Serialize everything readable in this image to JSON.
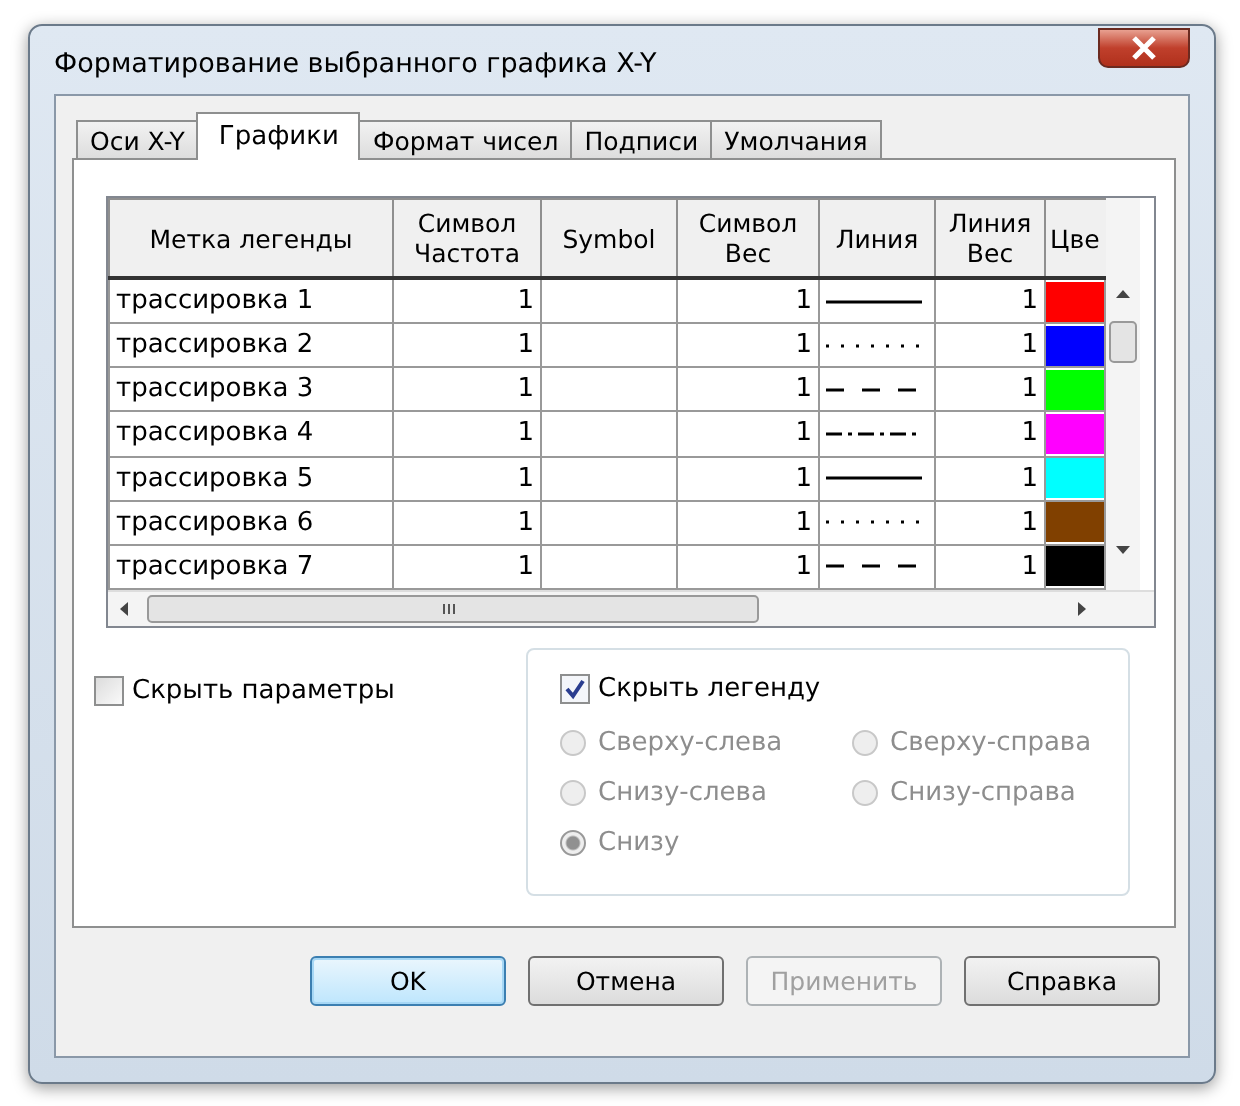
{
  "window": {
    "title": "Форматирование выбранного графика X-Y"
  },
  "tabs": [
    {
      "label": "Оси X-Y",
      "selected": false
    },
    {
      "label": "Графики",
      "selected": true
    },
    {
      "label": "Формат чисел",
      "selected": false
    },
    {
      "label": "Подписи",
      "selected": false
    },
    {
      "label": "Умолчания",
      "selected": false
    }
  ],
  "table": {
    "columns": [
      "Метка легенды",
      "Символ Частота",
      "Symbol",
      "Символ Вес",
      "Линия",
      "Линия Вес",
      "Цве"
    ],
    "rows": [
      {
        "label": "трассировка 1",
        "frequency": "1",
        "symbol_weight": "1",
        "kind": "solid",
        "line_weight": "1",
        "color": "#ff0000"
      },
      {
        "label": "трассировка 2",
        "frequency": "1",
        "symbol_weight": "1",
        "kind": "dotted",
        "line_weight": "1",
        "color": "#0000ff"
      },
      {
        "label": "трассировка 3",
        "frequency": "1",
        "symbol_weight": "1",
        "kind": "dashed",
        "line_weight": "1",
        "color": "#00ff00"
      },
      {
        "label": "трассировка 4",
        "frequency": "1",
        "symbol_weight": "1",
        "kind": "dashdot",
        "line_weight": "1",
        "color": "#ff00ff"
      },
      {
        "label": "трассировка 5",
        "frequency": "1",
        "symbol_weight": "1",
        "kind": "solid",
        "line_weight": "1",
        "color": "#00ffff"
      },
      {
        "label": "трассировка 6",
        "frequency": "1",
        "symbol_weight": "1",
        "kind": "dotted",
        "line_weight": "1",
        "color": "#804000"
      },
      {
        "label": "трассировка 7",
        "frequency": "1",
        "symbol_weight": "1",
        "kind": "dashed",
        "line_weight": "1",
        "color": "#000000"
      }
    ]
  },
  "hide_params": {
    "label": "Скрыть параметры",
    "checked": false
  },
  "legend": {
    "label": "Скрыть легенду",
    "checked": true,
    "positions": [
      {
        "label": "Сверху-слева",
        "selected": false,
        "disabled": true
      },
      {
        "label": "Сверху-справа",
        "selected": false,
        "disabled": true
      },
      {
        "label": "Снизу-слева",
        "selected": false,
        "disabled": true
      },
      {
        "label": "Снизу-справа",
        "selected": false,
        "disabled": true
      },
      {
        "label": "Снизу",
        "selected": true,
        "disabled": true
      }
    ]
  },
  "buttons": [
    {
      "label": "OK",
      "kind": "default",
      "disabled": false
    },
    {
      "label": "Отмена",
      "kind": "normal",
      "disabled": false
    },
    {
      "label": "Применить",
      "kind": "normal",
      "disabled": true
    },
    {
      "label": "Справка",
      "kind": "normal",
      "disabled": false
    }
  ]
}
